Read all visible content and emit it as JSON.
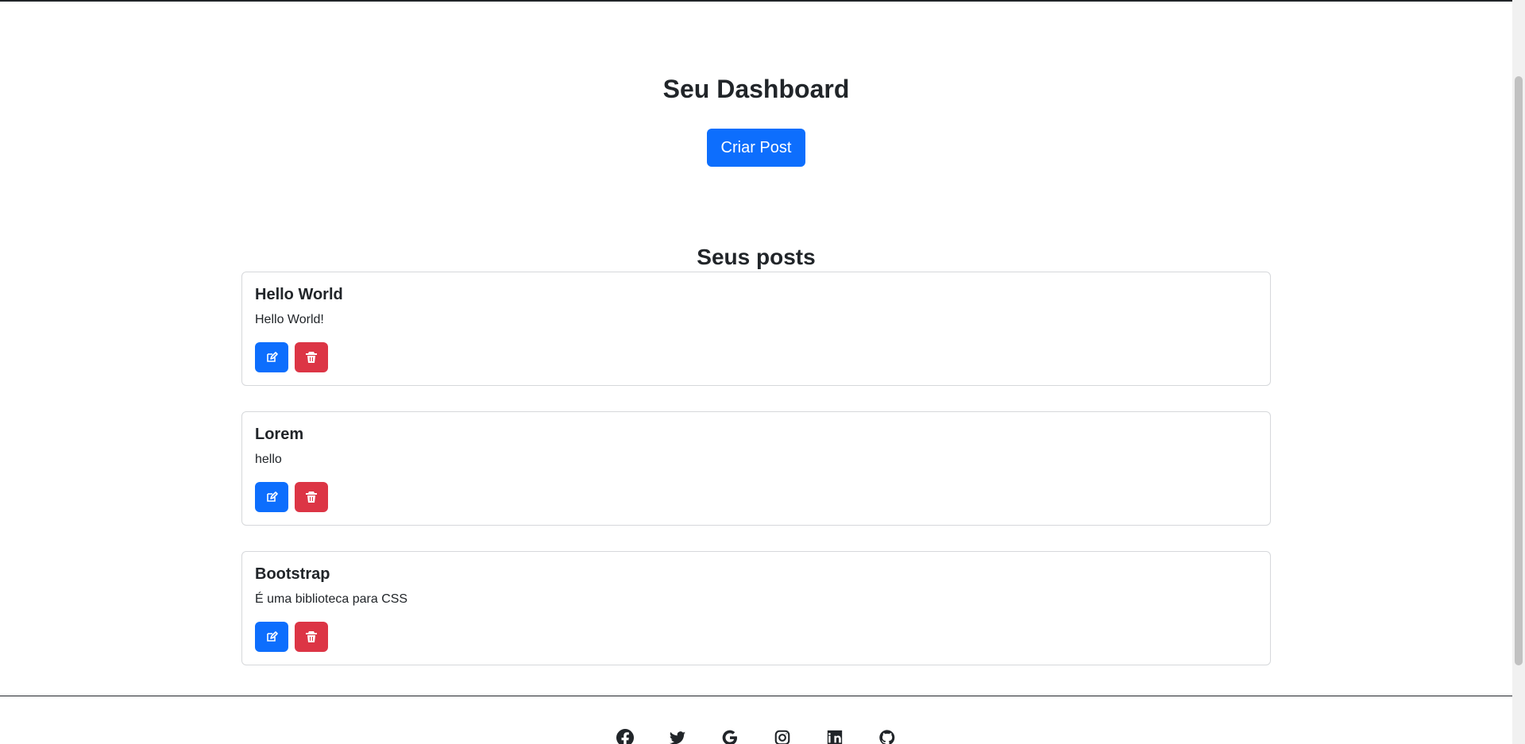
{
  "dashboard": {
    "title": "Seu Dashboard",
    "create_post_label": "Criar Post"
  },
  "posts": {
    "section_title": "Seus posts",
    "items": [
      {
        "title": "Hello World",
        "body": "Hello World!"
      },
      {
        "title": "Lorem",
        "body": "hello"
      },
      {
        "title": "Bootstrap",
        "body": "É uma biblioteca para CSS"
      }
    ]
  },
  "footer": {
    "social_icons": [
      "facebook-icon",
      "twitter-icon",
      "google-icon",
      "instagram-icon",
      "linkedin-icon",
      "github-icon"
    ]
  },
  "colors": {
    "primary": "#0d6efd",
    "danger": "#dc3545",
    "text": "#212529",
    "border": "#d6d8db",
    "background": "#ffffff"
  }
}
